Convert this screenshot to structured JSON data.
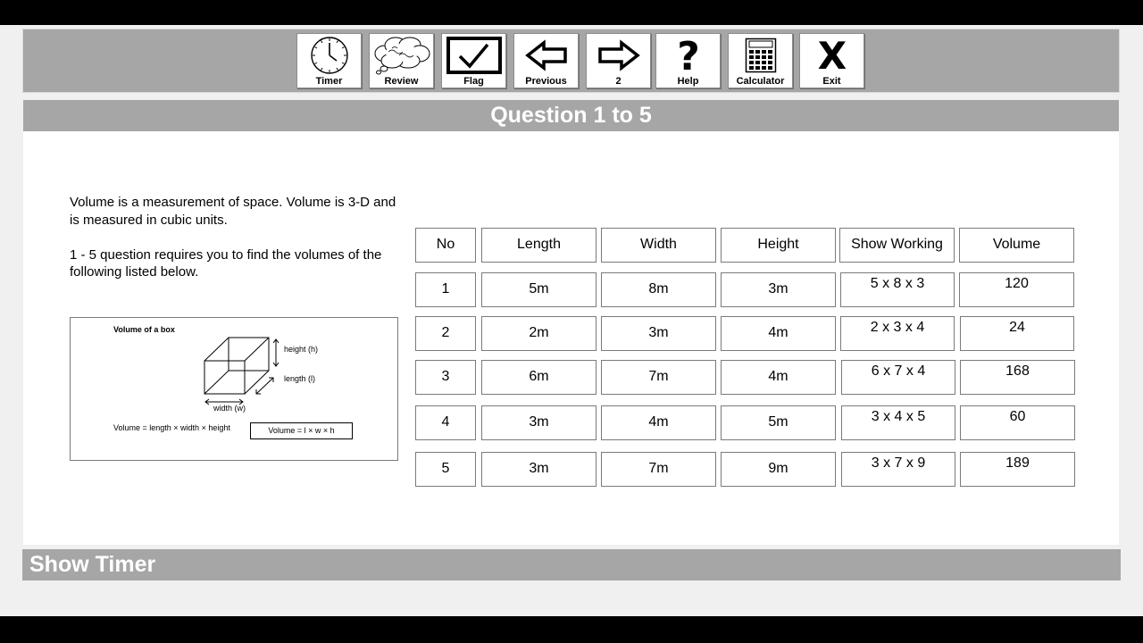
{
  "toolbar": {
    "buttons": [
      {
        "label": "Timer",
        "icon": "clock-icon"
      },
      {
        "label": "Review",
        "icon": "thought-cloud-icon"
      },
      {
        "label": "Flag",
        "icon": "checkmark-icon"
      },
      {
        "label": "Previous",
        "icon": "arrow-left-icon"
      },
      {
        "label": "2",
        "icon": "arrow-right-icon"
      },
      {
        "label": "Help",
        "icon": "question-mark-icon"
      },
      {
        "label": "Calculator",
        "icon": "calculator-icon"
      },
      {
        "label": "Exit",
        "icon": "x-icon"
      }
    ]
  },
  "question": {
    "title": "Question 1 to 5"
  },
  "intro": {
    "paragraph1": "Volume is a measurement of space. Volume is 3-D and is measured in cubic units.",
    "paragraph2": "1 - 5 question requires you to find the volumes of the following listed below."
  },
  "figure": {
    "title": "Volume of a box",
    "height_label": "height (h)",
    "length_label": "length (l)",
    "width_label": "width (w)",
    "formula_text": "Volume = length × width × height",
    "formula_box": "Volume = l × w × h"
  },
  "table": {
    "headers": [
      "No",
      "Length",
      "Width",
      "Height",
      "Show Working",
      "Volume"
    ],
    "rows": [
      {
        "no": "1",
        "length": "5m",
        "width": "8m",
        "height": "3m",
        "working": "5 x 8 x 3",
        "volume": "120"
      },
      {
        "no": "2",
        "length": "2m",
        "width": "3m",
        "height": "4m",
        "working": "2 x 3 x 4",
        "volume": "24"
      },
      {
        "no": "3",
        "length": "6m",
        "width": "7m",
        "height": "4m",
        "working": "6 x 7 x 4",
        "volume": "168"
      },
      {
        "no": "4",
        "length": "3m",
        "width": "4m",
        "height": "5m",
        "working": "3 x 4 x 5",
        "volume": "60"
      },
      {
        "no": "5",
        "length": "3m",
        "width": "7m",
        "height": "9m",
        "working": "3 x 7 x 9",
        "volume": "189"
      }
    ]
  },
  "footer": {
    "timer_label": "Show Timer"
  }
}
